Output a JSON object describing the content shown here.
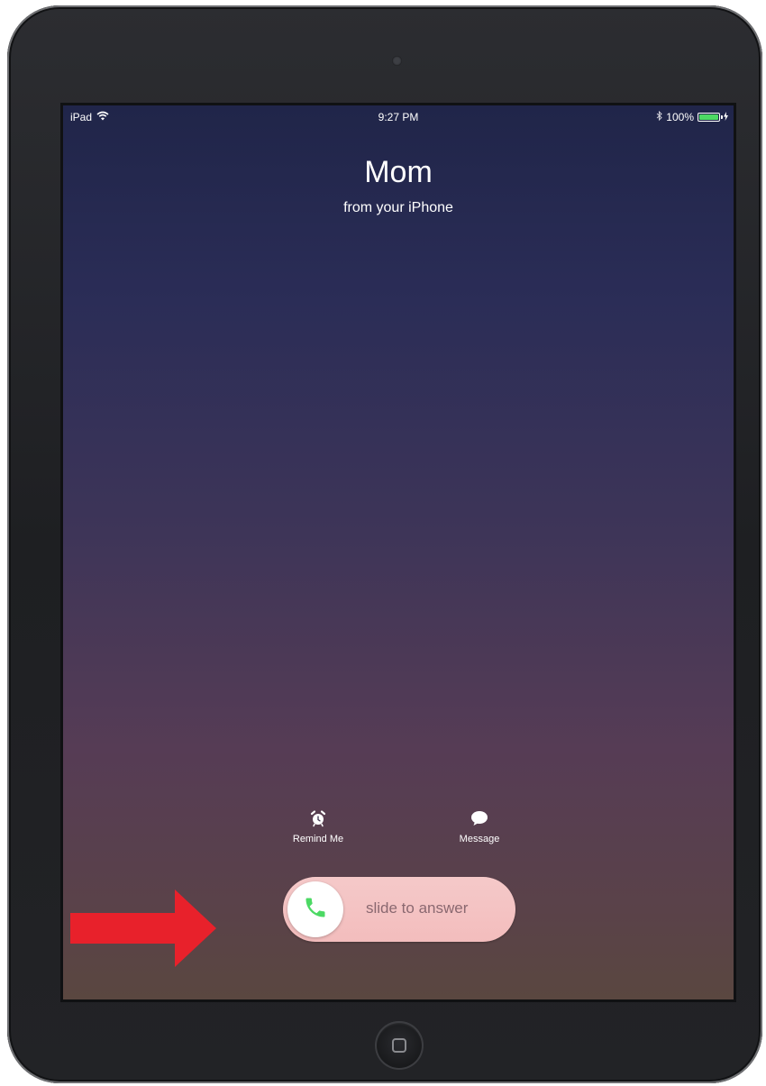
{
  "status_bar": {
    "device": "iPad",
    "time": "9:27 PM",
    "battery": "100%",
    "battery_level": 1.0,
    "icons": [
      "wifi-icon",
      "bluetooth-icon",
      "battery-icon",
      "charging-icon"
    ]
  },
  "call": {
    "caller_name": "Mom",
    "subtitle": "from your iPhone"
  },
  "actions": {
    "remind_me": {
      "label": "Remind Me",
      "icon": "alarm-clock-icon"
    },
    "message": {
      "label": "Message",
      "icon": "speech-bubble-icon"
    }
  },
  "answer_slider": {
    "label": "slide to answer",
    "icon": "phone-icon"
  },
  "annotation": {
    "icon": "arrow-right-icon"
  },
  "colors": {
    "battery_fill": "#4cd964",
    "phone_icon": "#4cd964",
    "slider_track": "#f3bdbd",
    "annotation_arrow": "#e8212b"
  }
}
